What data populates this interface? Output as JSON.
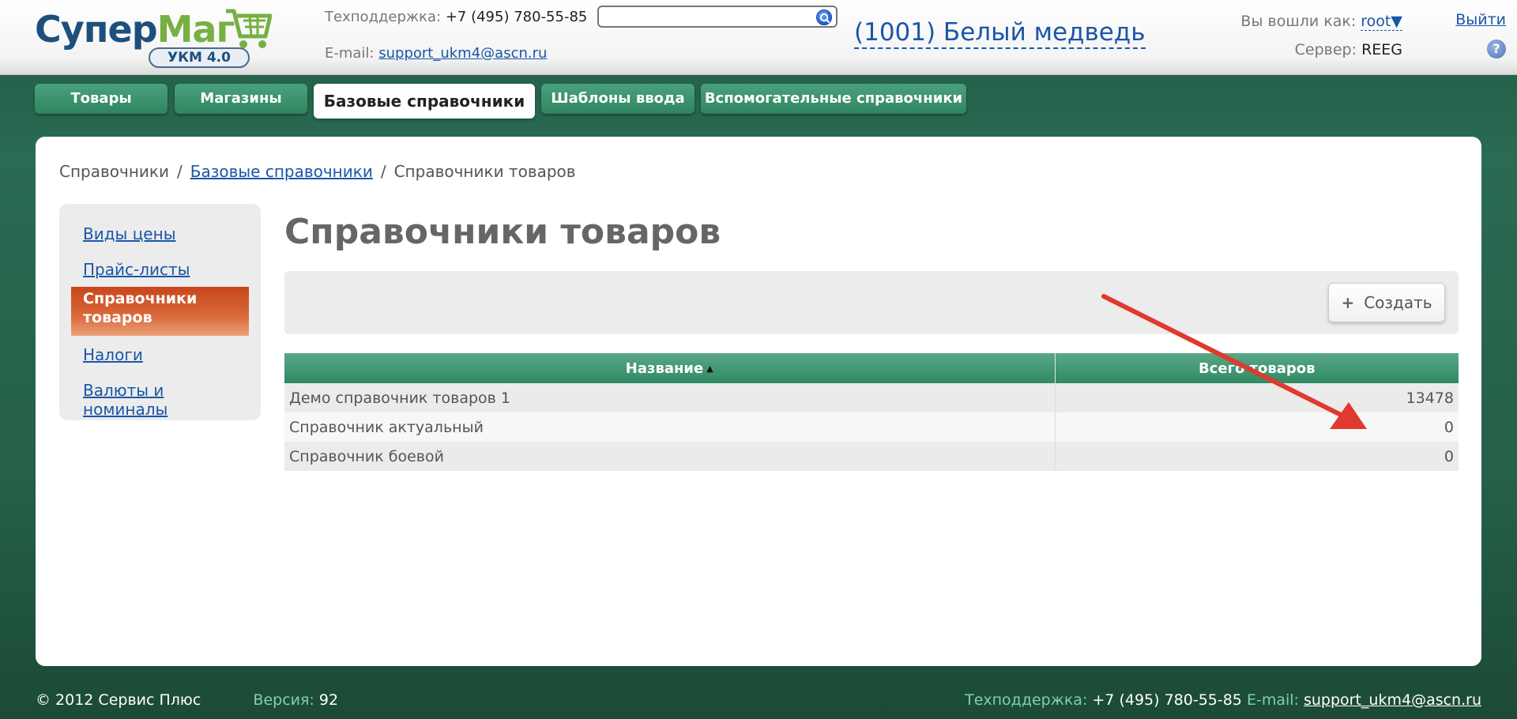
{
  "logo": {
    "text_blue": "Супер",
    "text_green": "Маг",
    "badge": "УКМ 4.0"
  },
  "support": {
    "phone_label": "Техподдержка:",
    "phone": "+7 (495) 780-55-85",
    "email_label": "E-mail:",
    "email": "support_ukm4@ascn.ru"
  },
  "search": {
    "value": ""
  },
  "store": {
    "name": "(1001) Белый медведь"
  },
  "user": {
    "logged_in_label": "Вы вошли как:",
    "username": "root",
    "dropdown_glyph": "▼",
    "logout": "Выйти",
    "server_label": "Сервер:",
    "server": "REEG",
    "help": "?"
  },
  "tabs": [
    {
      "label": "Товары"
    },
    {
      "label": "Магазины"
    },
    {
      "label": "Базовые справочники",
      "active": true
    },
    {
      "label": "Шаблоны ввода"
    },
    {
      "label": "Вспомогательные справочники"
    }
  ],
  "breadcrumb": {
    "root": "Справочники",
    "section": "Базовые справочники",
    "current": "Справочники товаров",
    "separator": "/"
  },
  "sidebar": {
    "items": [
      {
        "label": "Виды цены"
      },
      {
        "label": "Прайс-листы"
      },
      {
        "label": "Справочники товаров",
        "active": true
      },
      {
        "label": "Налоги"
      },
      {
        "label": "Валюты и номиналы"
      }
    ]
  },
  "page": {
    "title": "Справочники товаров"
  },
  "toolbar": {
    "create_label": "Создать",
    "create_icon": "+"
  },
  "table": {
    "columns": [
      "Название",
      "Всего товаров"
    ],
    "sort_glyph": "▲",
    "rows": [
      {
        "name": "Демо справочник товаров 1",
        "total": "13478"
      },
      {
        "name": "Справочник актуальный",
        "total": "0"
      },
      {
        "name": "Справочник боевой",
        "total": "0"
      }
    ]
  },
  "footer": {
    "copyright": "© 2012 Сервис Плюс",
    "version_label": "Версия:",
    "version": "92",
    "phone_label": "Техподдержка:",
    "phone": "+7 (495) 780-55-85",
    "email_label": "E-mail:",
    "email": "support_ukm4@ascn.ru"
  },
  "colors": {
    "brand_blue": "#1d4f7c",
    "brand_green": "#76b043",
    "tab_green": "#2f855f",
    "active_side_item": "#c8461c",
    "annotation_arrow": "#e03a2e"
  }
}
